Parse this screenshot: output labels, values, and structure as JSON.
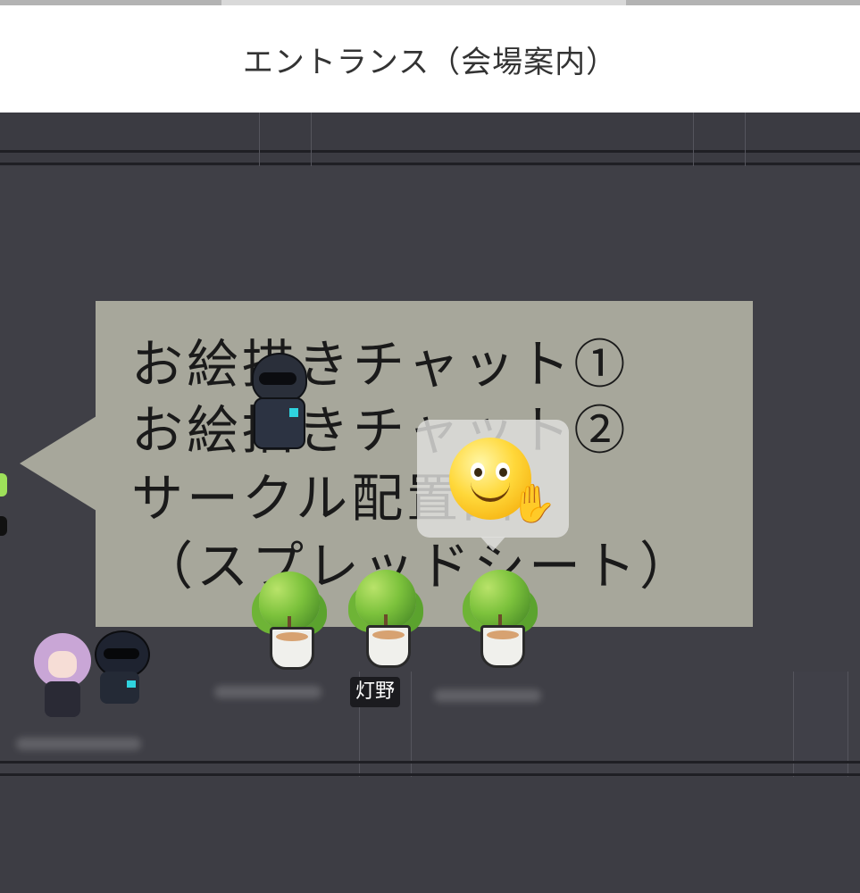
{
  "header": {
    "title": "エントランス（会場案内）"
  },
  "sign": {
    "lines": [
      "お絵描きチャット①",
      "お絵描きチャット②",
      "サークル配置図",
      "（スプレッドシート）"
    ]
  },
  "emote": {
    "icon": "waving-smiley-icon",
    "hand": "✋"
  },
  "players": [
    {
      "name": "灯野"
    }
  ],
  "colors": {
    "floor": "#3f3f46",
    "sign_bg": "#a7a79b",
    "header_bg": "#ffffff"
  }
}
